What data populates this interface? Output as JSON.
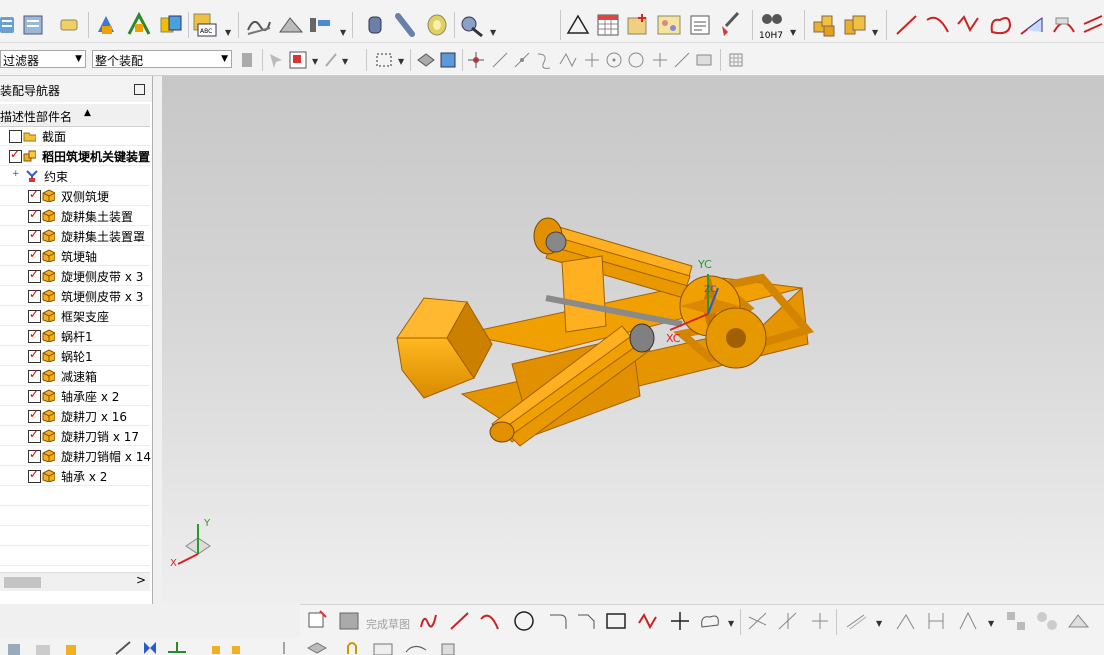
{
  "filter": {
    "selection_filter": "过滤器",
    "assembly_scope": "整个装配"
  },
  "toolbar": {
    "standard_fit": "10H7",
    "finish_sketch": "完成草图"
  },
  "navigator": {
    "title": "装配导航器",
    "column_header": "描述性部件名",
    "items": [
      {
        "label": "截面",
        "checked": false
      },
      {
        "label": "稻田筑埂机关键装置",
        "checked": true
      },
      {
        "label": "约束",
        "checked": false
      },
      {
        "label": "双侧筑埂",
        "checked": true
      },
      {
        "label": "旋耕集土装置",
        "checked": true
      },
      {
        "label": "旋耕集土装置罩",
        "checked": true
      },
      {
        "label": "筑埂轴",
        "checked": true
      },
      {
        "label": "旋埂侧皮带 x 3",
        "checked": true
      },
      {
        "label": "筑埂侧皮带 x 3",
        "checked": true
      },
      {
        "label": "框架支座",
        "checked": true
      },
      {
        "label": "蜗杆1",
        "checked": true
      },
      {
        "label": "蜗轮1",
        "checked": true
      },
      {
        "label": "减速箱",
        "checked": true
      },
      {
        "label": "轴承座 x 2",
        "checked": true
      },
      {
        "label": "旋耕刀 x 16",
        "checked": true
      },
      {
        "label": "旋耕刀销 x 17",
        "checked": true
      },
      {
        "label": "旋耕刀销帽 x 14",
        "checked": true
      },
      {
        "label": "轴承 x 2",
        "checked": true
      }
    ],
    "scroll_arrow": ">"
  },
  "viewport": {
    "wcs_labels": {
      "yc": "YC",
      "xc": "XC",
      "zc": "ZC"
    },
    "triad_labels": {
      "x": "X",
      "y": "Y"
    }
  },
  "colors": {
    "part": "#f0a000",
    "part_dark": "#c97800",
    "part_light": "#ffc040",
    "check": "#dd0000"
  }
}
